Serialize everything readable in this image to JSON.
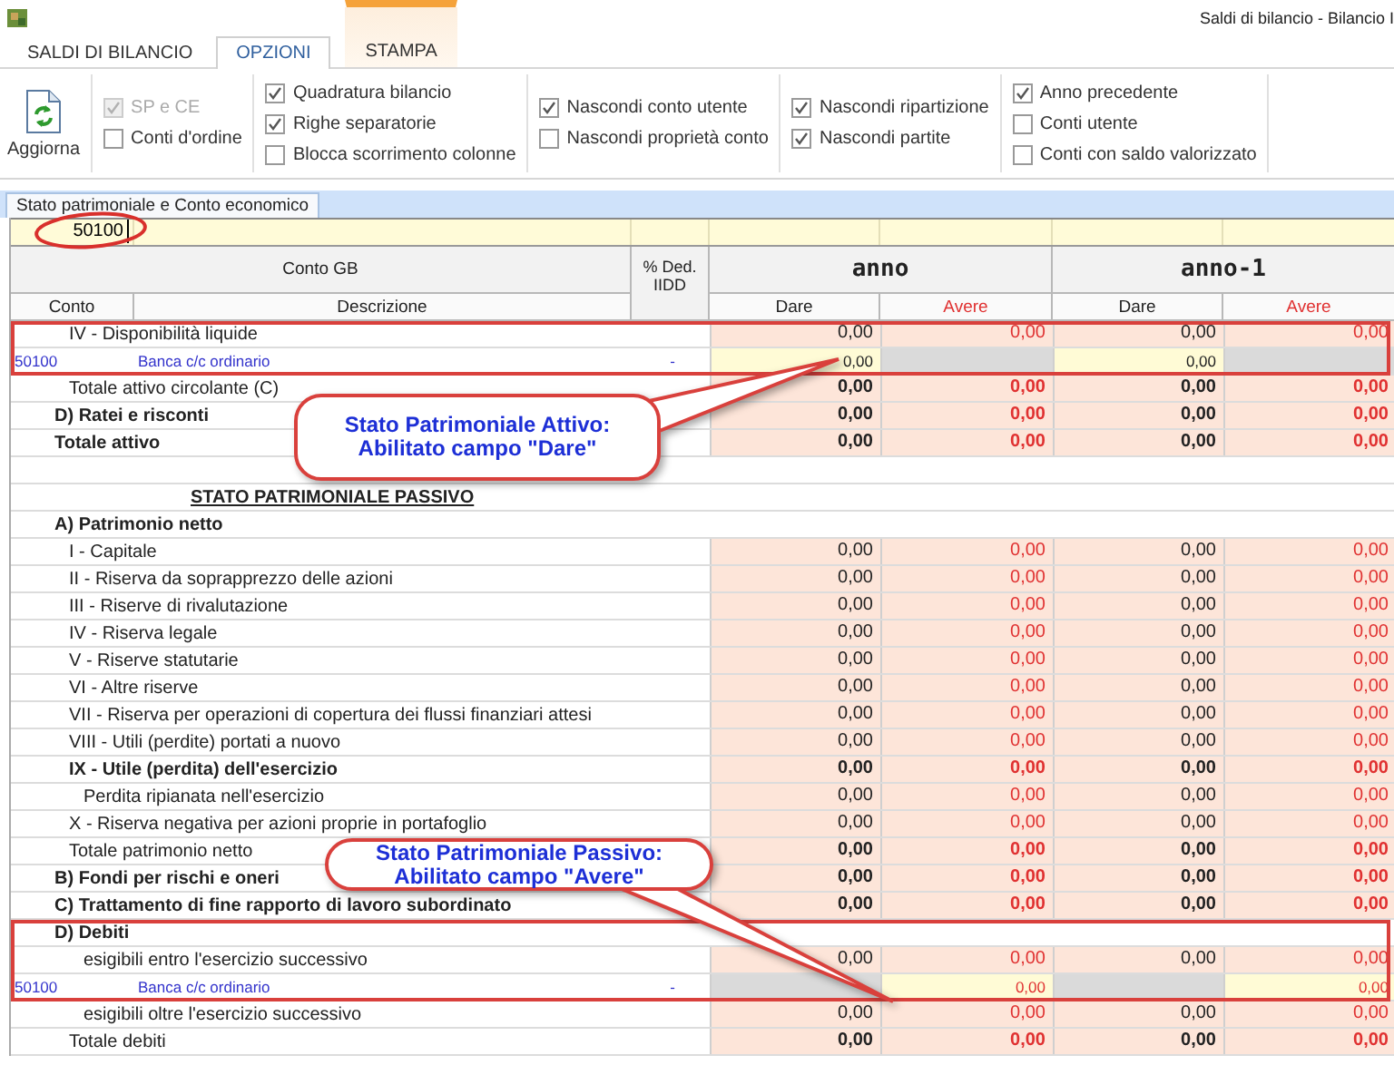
{
  "window": {
    "title": "Saldi di bilancio - Bilancio I"
  },
  "ribbon_tabs": [
    {
      "label": "SALDI DI BILANCIO",
      "selected": false,
      "contextual": false
    },
    {
      "label": "OPZIONI",
      "selected": true,
      "contextual": false
    },
    {
      "label": "STAMPA",
      "selected": false,
      "contextual": true
    }
  ],
  "refresh_button": {
    "label": "Aggiorna"
  },
  "option_groups": [
    [
      {
        "label": "SP e CE",
        "checked": true,
        "disabled": true
      },
      {
        "label": "Conti d'ordine",
        "checked": false,
        "disabled": false
      }
    ],
    [
      {
        "label": "Quadratura bilancio",
        "checked": true,
        "disabled": false
      },
      {
        "label": "Righe separatorie",
        "checked": true,
        "disabled": false
      },
      {
        "label": "Blocca scorrimento colonne",
        "checked": false,
        "disabled": false
      }
    ],
    [
      {
        "label": "Nascondi conto utente",
        "checked": true,
        "disabled": false
      },
      {
        "label": "Nascondi proprietà conto",
        "checked": false,
        "disabled": false
      }
    ],
    [
      {
        "label": "Nascondi ripartizione",
        "checked": true,
        "disabled": false
      },
      {
        "label": "Nascondi partite",
        "checked": true,
        "disabled": false
      }
    ],
    [
      {
        "label": "Anno precedente",
        "checked": true,
        "disabled": false
      },
      {
        "label": "Conti utente",
        "checked": false,
        "disabled": false
      },
      {
        "label": "Conti con saldo valorizzato",
        "checked": false,
        "disabled": false
      }
    ]
  ],
  "sheet_tabs": [
    {
      "label": "Stato patrimoniale e Conto economico",
      "selected": true
    }
  ],
  "filter": {
    "value": "50100"
  },
  "table": {
    "group_header": "Conto GB",
    "conto_header": "Conto",
    "description_header": "Descrizione",
    "ded_header": "% Ded. IIDD",
    "periods": [
      {
        "label": "anno",
        "columns": [
          {
            "label": "Dare",
            "kind": "debit"
          },
          {
            "label": "Avere",
            "kind": "credit"
          }
        ]
      },
      {
        "label": "anno-1",
        "columns": [
          {
            "label": "Dare",
            "kind": "debit"
          },
          {
            "label": "Avere",
            "kind": "credit"
          }
        ]
      }
    ],
    "rows": [
      {
        "kind": "item",
        "text": "IV - Disponibilità liquide",
        "values": [
          "0,00",
          "0,00",
          "0,00",
          "0,00"
        ],
        "framed": true
      },
      {
        "kind": "detail",
        "conto": "50100",
        "text": "Banca c/c ordinario",
        "ded": "-",
        "cells": [
          {
            "text": "0,00",
            "enabled": true
          },
          {
            "enabled": false
          },
          {
            "text": "0,00",
            "enabled": true
          },
          {
            "enabled": false
          }
        ],
        "framed": true
      },
      {
        "kind": "total",
        "text": "Totale attivo circolante (C)",
        "values": [
          "0,00",
          "0,00",
          "0,00",
          "0,00"
        ],
        "framed": false
      },
      {
        "kind": "section",
        "text": "D) Ratei e risconti",
        "values": [
          "0,00",
          "0,00",
          "0,00",
          "0,00"
        ],
        "framed": false
      },
      {
        "kind": "section",
        "text": "Totale attivo",
        "values": [
          "0,00",
          "0,00",
          "0,00",
          "0,00"
        ],
        "framed": false
      },
      {
        "kind": "blank",
        "framed": false
      },
      {
        "kind": "heading",
        "text": "STATO PATRIMONIALE PASSIVO",
        "framed": false
      },
      {
        "kind": "section",
        "text": "A) Patrimonio netto",
        "framed": false
      },
      {
        "kind": "item",
        "text": "I - Capitale",
        "values": [
          "0,00",
          "0,00",
          "0,00",
          "0,00"
        ],
        "framed": false
      },
      {
        "kind": "item",
        "text": "II - Riserva da soprapprezzo delle azioni",
        "values": [
          "0,00",
          "0,00",
          "0,00",
          "0,00"
        ],
        "framed": false
      },
      {
        "kind": "item",
        "text": "III - Riserve di rivalutazione",
        "values": [
          "0,00",
          "0,00",
          "0,00",
          "0,00"
        ],
        "framed": false
      },
      {
        "kind": "item",
        "text": "IV - Riserva legale",
        "values": [
          "0,00",
          "0,00",
          "0,00",
          "0,00"
        ],
        "framed": false
      },
      {
        "kind": "item",
        "text": "V - Riserve statutarie",
        "values": [
          "0,00",
          "0,00",
          "0,00",
          "0,00"
        ],
        "framed": false
      },
      {
        "kind": "item",
        "text": "VI - Altre riserve",
        "values": [
          "0,00",
          "0,00",
          "0,00",
          "0,00"
        ],
        "framed": false
      },
      {
        "kind": "item",
        "text": "VII - Riserva per operazioni di copertura dei flussi finanziari attesi",
        "values": [
          "0,00",
          "0,00",
          "0,00",
          "0,00"
        ],
        "framed": false
      },
      {
        "kind": "item",
        "text": "VIII - Utili (perdite) portati a nuovo",
        "values": [
          "0,00",
          "0,00",
          "0,00",
          "0,00"
        ],
        "framed": false
      },
      {
        "kind": "item_strong",
        "text": "IX - Utile (perdita) dell'esercizio",
        "values": [
          "0,00",
          "0,00",
          "0,00",
          "0,00"
        ],
        "framed": false
      },
      {
        "kind": "subitem",
        "text": "Perdita ripianata nell'esercizio",
        "values": [
          "0,00",
          "0,00",
          "0,00",
          "0,00"
        ],
        "framed": false
      },
      {
        "kind": "item",
        "text": "X - Riserva negativa per azioni proprie in portafoglio",
        "values": [
          "0,00",
          "0,00",
          "0,00",
          "0,00"
        ],
        "framed": false
      },
      {
        "kind": "total",
        "text": "Totale patrimonio netto",
        "values": [
          "0,00",
          "0,00",
          "0,00",
          "0,00"
        ],
        "framed": false
      },
      {
        "kind": "section",
        "text": "B) Fondi per rischi e oneri",
        "values": [
          "0,00",
          "0,00",
          "0,00",
          "0,00"
        ],
        "framed": false
      },
      {
        "kind": "section",
        "text": "C) Trattamento di fine rapporto di lavoro subordinato",
        "values": [
          "0,00",
          "0,00",
          "0,00",
          "0,00"
        ],
        "framed": false
      },
      {
        "kind": "section",
        "text": "D) Debiti",
        "framed": true
      },
      {
        "kind": "subitem",
        "text": "esigibili entro l'esercizio successivo",
        "values": [
          "0,00",
          "0,00",
          "0,00",
          "0,00"
        ],
        "framed": true
      },
      {
        "kind": "detail",
        "conto": "50100",
        "text": "Banca c/c ordinario",
        "ded": "-",
        "cells": [
          {
            "enabled": false
          },
          {
            "text": "0,00",
            "enabled": true
          },
          {
            "enabled": false
          },
          {
            "text": "0,00",
            "enabled": true
          }
        ],
        "framed": true
      },
      {
        "kind": "subitem",
        "text": "esigibili oltre l'esercizio successivo",
        "values": [
          "0,00",
          "0,00",
          "0,00",
          "0,00"
        ],
        "framed": false
      },
      {
        "kind": "total",
        "text": "Totale debiti",
        "values": [
          "0,00",
          "0,00",
          "0,00",
          "0,00"
        ],
        "framed": false
      }
    ]
  },
  "callouts": [
    {
      "text": "Stato Patrimoniale Attivo:\nAbilitato campo \"Dare\""
    },
    {
      "text": "Stato Patrimoniale Passivo:\nAbilitato campo \"Avere\""
    }
  ]
}
